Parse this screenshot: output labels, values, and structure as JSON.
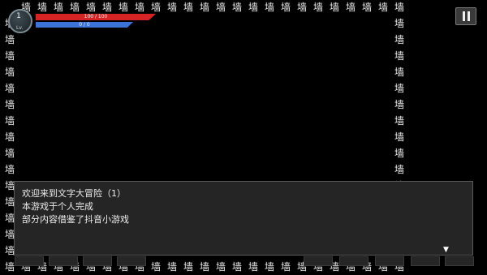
{
  "wall_char": "墙",
  "hud": {
    "level": "1",
    "level_tag": "Lv.",
    "hp_text": "100 / 100",
    "hp_fraction": 1.0,
    "mp_text": "0 / 0",
    "mp_fraction": 1.0
  },
  "pause_icon": "pause-icon",
  "dialog": {
    "lines": [
      "欢迎来到文字大冒险（1）",
      "本游戏于个人完成",
      "部分内容借鉴了抖音小游戏"
    ],
    "continue_indicator": "▼"
  },
  "colors": {
    "hp": "#d62424",
    "mp": "#3b74d6",
    "background": "#000000",
    "dialog_bg": "#252525"
  }
}
